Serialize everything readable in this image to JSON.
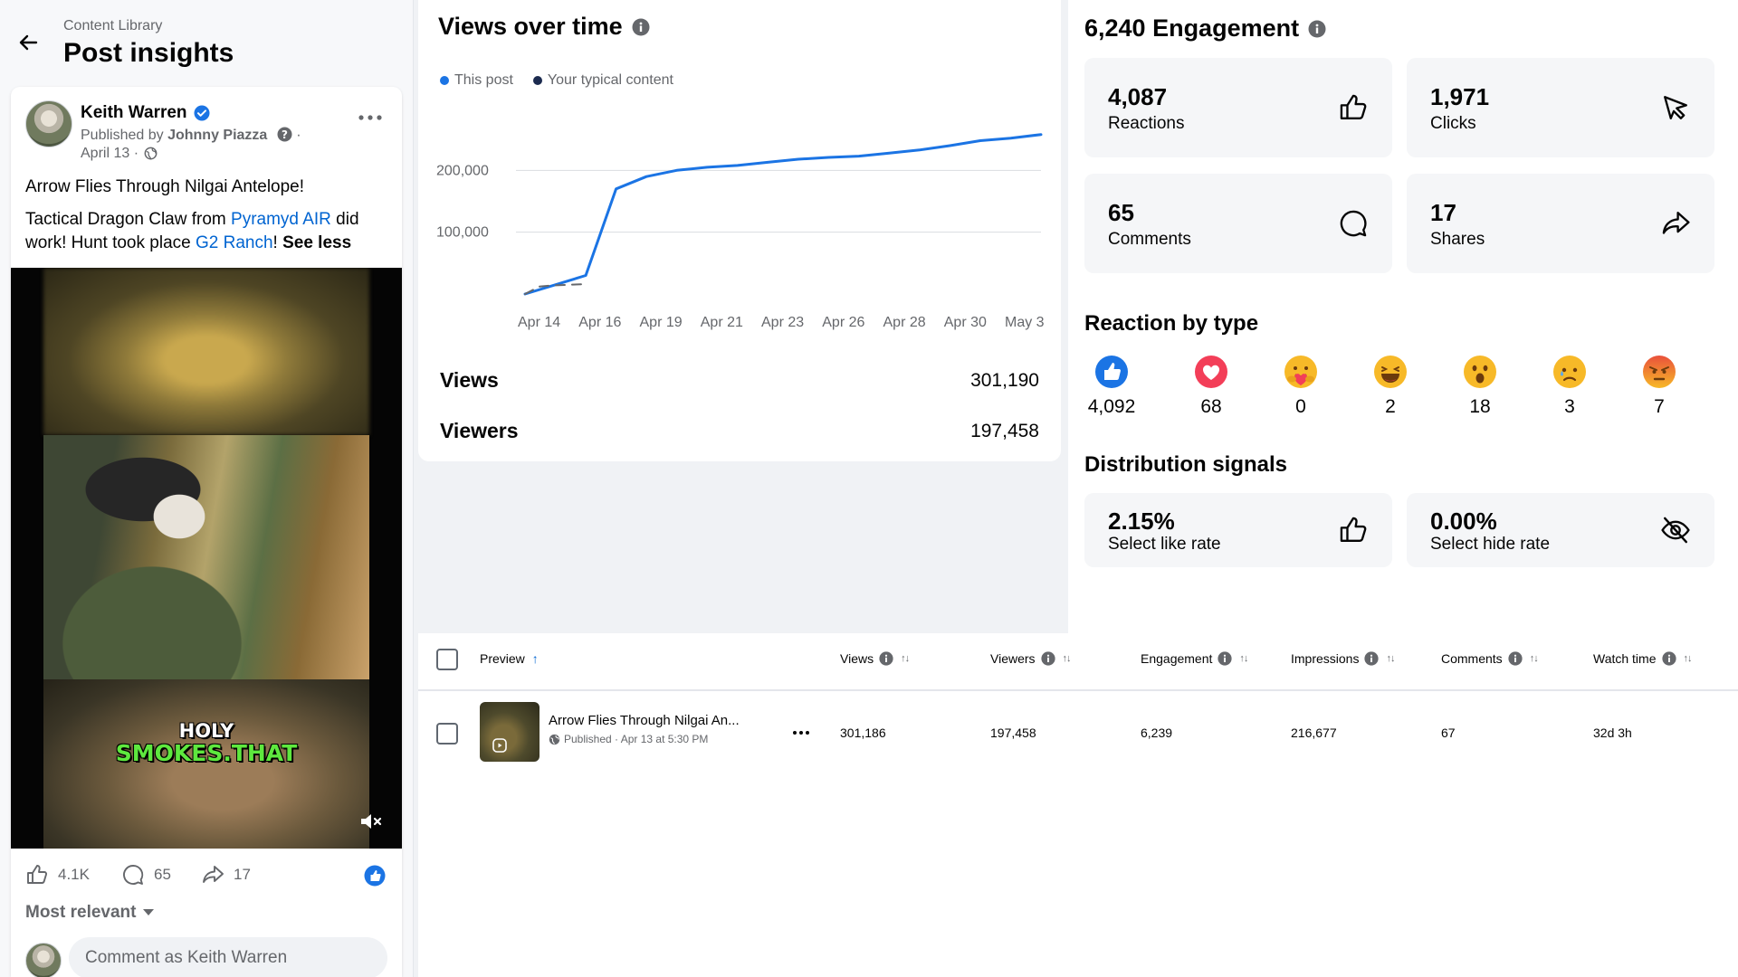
{
  "header": {
    "breadcrumb": "Content Library",
    "title": "Post insights"
  },
  "post": {
    "author": "Keith Warren",
    "published_by_prefix": "Published by",
    "published_by": "Johnny Piazza",
    "date": "April 13",
    "date_sep": " · ",
    "title": "Arrow Flies Through Nilgai Antelope!",
    "body": {
      "part1": "Tactical Dragon Claw from ",
      "link1": "Pyramyd AIR",
      "part2": " did work! Hunt took place ",
      "link2": "G2 Ranch",
      "part3": "! ",
      "see_less": "See less"
    },
    "video_caption_line1": "HOLY",
    "video_caption_line2": "SMOKES.THAT",
    "likes": "4.1K",
    "comments": "65",
    "shares": "17",
    "sort_label": "Most relevant",
    "comment_placeholder": "Comment as Keith Warren"
  },
  "views_panel": {
    "title": "Views over time",
    "legend": [
      {
        "label": "This post",
        "color": "#1b74e4"
      },
      {
        "label": "Your typical content",
        "color": "#1c2b4f"
      }
    ],
    "views_label": "Views",
    "views_value": "301,190",
    "viewers_label": "Viewers",
    "viewers_value": "197,458"
  },
  "chart_data": {
    "type": "line",
    "x": [
      "Apr 13",
      "Apr 13.5",
      "Apr 14",
      "Apr 14.5",
      "Apr 15",
      "Apr 15.5",
      "Apr 16",
      "Apr 17",
      "Apr 18",
      "Apr 19",
      "Apr 21",
      "Apr 23",
      "Apr 26",
      "Apr 28",
      "Apr 30",
      "May 1",
      "May 3",
      "May 4"
    ],
    "xticks": [
      "Apr 14",
      "Apr 16",
      "Apr 19",
      "Apr 21",
      "Apr 23",
      "Apr 26",
      "Apr 28",
      "Apr 30",
      "May 3"
    ],
    "yticks": [
      "100,000",
      "200,000"
    ],
    "ylim": [
      0,
      300000
    ],
    "series": [
      {
        "name": "This post",
        "color": "#1b74e4",
        "values": [
          0,
          15000,
          30000,
          170000,
          190000,
          200000,
          205000,
          208000,
          213000,
          218000,
          221000,
          223000,
          228000,
          233000,
          240000,
          248000,
          252000,
          258000
        ]
      },
      {
        "name": "Your typical content",
        "color": "#65676b",
        "dashed": true,
        "values": [
          0,
          12000,
          14000,
          15000,
          16000
        ]
      }
    ]
  },
  "engagement": {
    "title": "6,240 Engagement",
    "cards": [
      {
        "value": "4,087",
        "label": "Reactions",
        "icon": "thumbs-up-icon"
      },
      {
        "value": "1,971",
        "label": "Clicks",
        "icon": "cursor-icon"
      },
      {
        "value": "65",
        "label": "Comments",
        "icon": "comment-icon"
      },
      {
        "value": "17",
        "label": "Shares",
        "icon": "share-icon"
      }
    ],
    "reaction_title": "Reaction by type",
    "reactions": [
      {
        "type": "like",
        "count": "4,092"
      },
      {
        "type": "love",
        "count": "68"
      },
      {
        "type": "care",
        "count": "0"
      },
      {
        "type": "haha",
        "count": "2"
      },
      {
        "type": "wow",
        "count": "18"
      },
      {
        "type": "sad",
        "count": "3"
      },
      {
        "type": "angry",
        "count": "7"
      }
    ],
    "distribution_title": "Distribution signals",
    "signals": [
      {
        "value": "2.15%",
        "label": "Select like rate",
        "icon": "thumbs-up-icon"
      },
      {
        "value": "0.00%",
        "label": "Select hide rate",
        "icon": "eye-off-icon"
      }
    ]
  },
  "table": {
    "columns": [
      "Preview",
      "Views",
      "Viewers",
      "Engagement",
      "Impressions",
      "Comments",
      "Watch time"
    ],
    "row": {
      "title": "Arrow Flies Through Nilgai An...",
      "meta": "Published · Apr 13 at 5:30 PM",
      "views": "301,186",
      "viewers": "197,458",
      "engagement": "6,239",
      "impressions": "216,677",
      "comments": "67",
      "watch_time": "32d 3h"
    }
  },
  "colors": {
    "accent": "#1b74e4",
    "link": "#0064d1",
    "muted": "#65676b"
  }
}
